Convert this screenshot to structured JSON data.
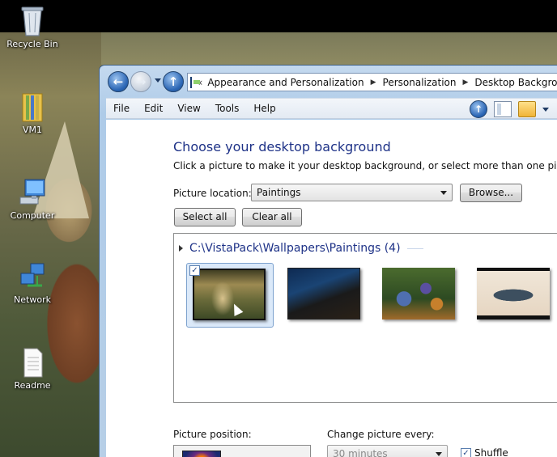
{
  "desktop": {
    "icons": [
      {
        "name": "recycle-bin",
        "label": "Recycle Bin"
      },
      {
        "name": "vm1-folder",
        "label": "VM1"
      },
      {
        "name": "computer",
        "label": "Computer"
      },
      {
        "name": "network",
        "label": "Network"
      },
      {
        "name": "readme",
        "label": "Readme"
      }
    ]
  },
  "window": {
    "address": {
      "first": "«",
      "crumbs": [
        "Appearance and Personalization",
        "Personalization",
        "Desktop Background"
      ]
    },
    "menu": [
      "File",
      "Edit",
      "View",
      "Tools",
      "Help"
    ],
    "heading": "Choose your desktop background",
    "subtext": "Click a picture to make it your desktop background, or select more than one picture to cre",
    "picture_location": {
      "label": "Picture location:",
      "value": "Paintings",
      "browse_label": "Browse..."
    },
    "select_all_label": "Select all",
    "clear_all_label": "Clear all",
    "gallery": {
      "group_title": "C:\\VistaPack\\Wallpapers\\Paintings (4)",
      "thumbnails": [
        {
          "name": "painting-sunday-afternoon",
          "selected": true,
          "checked": true
        },
        {
          "name": "painting-bridge-night",
          "selected": false,
          "checked": false
        },
        {
          "name": "painting-irises",
          "selected": false,
          "checked": false
        },
        {
          "name": "painting-carp",
          "selected": false,
          "checked": false
        }
      ]
    },
    "picture_position_label": "Picture position:",
    "change_every": {
      "label": "Change picture every:",
      "value": "30 minutes"
    },
    "shuffle": {
      "label": "Shuffle",
      "checked": true
    }
  }
}
